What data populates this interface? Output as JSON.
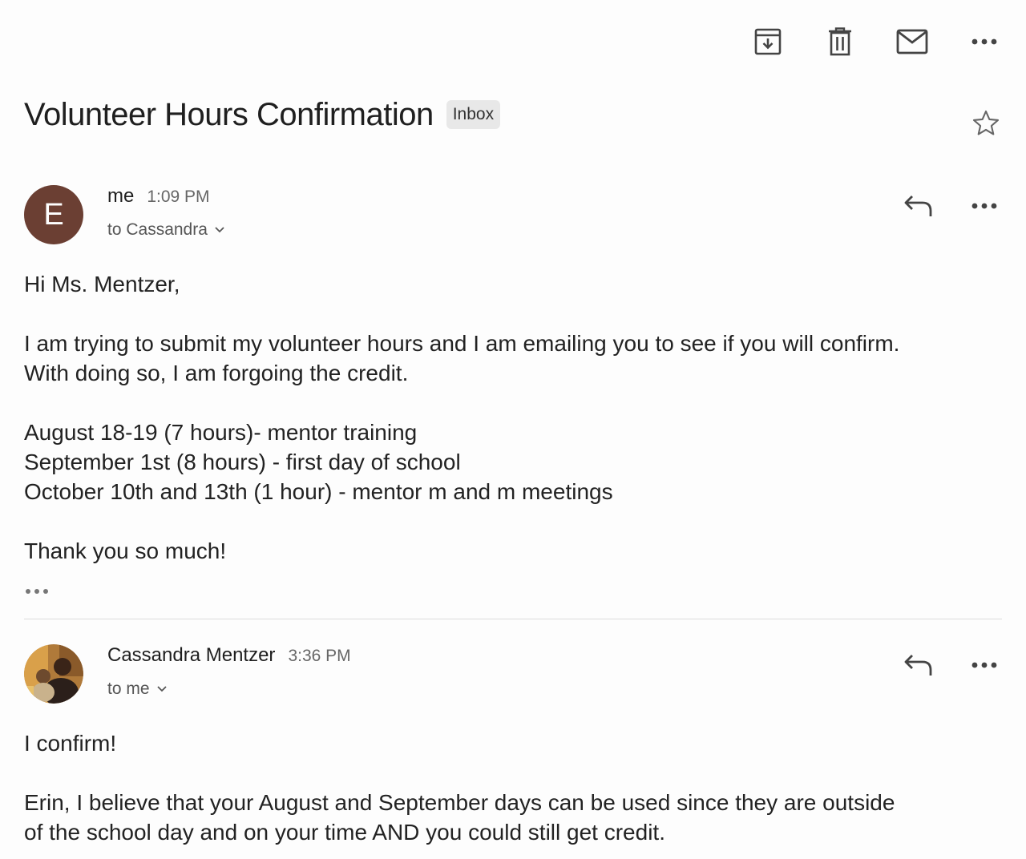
{
  "toolbar": {
    "archive_icon": "archive-icon",
    "delete_icon": "trash-icon",
    "mark_unread_icon": "mail-icon",
    "more_icon": "more-horizontal-icon"
  },
  "thread": {
    "subject": "Volunteer Hours Confirmation",
    "label": "Inbox",
    "starred": false
  },
  "messages": [
    {
      "avatar_letter": "E",
      "avatar_color": "#6b3f33",
      "sender": "me",
      "time": "1:09 PM",
      "recipient": "to Cassandra",
      "body": [
        "Hi Ms. Mentzer,",
        "",
        "I am trying to submit my volunteer hours and I am emailing you to see if you will confirm.",
        "With doing so, I am forgoing the credit.",
        "",
        "August 18-19 (7 hours)- mentor training",
        "September 1st (8 hours) - first day of school",
        "October 10th and 13th (1 hour) - mentor m and m meetings",
        "",
        "Thank you so much!"
      ]
    },
    {
      "avatar_type": "photo",
      "sender": "Cassandra Mentzer",
      "time": "3:36 PM",
      "recipient": "to me",
      "body": [
        "I confirm!",
        "",
        "Erin, I believe that your August and September days can be used since they are outside",
        "of the school day and on your time AND you could still get credit."
      ]
    }
  ]
}
